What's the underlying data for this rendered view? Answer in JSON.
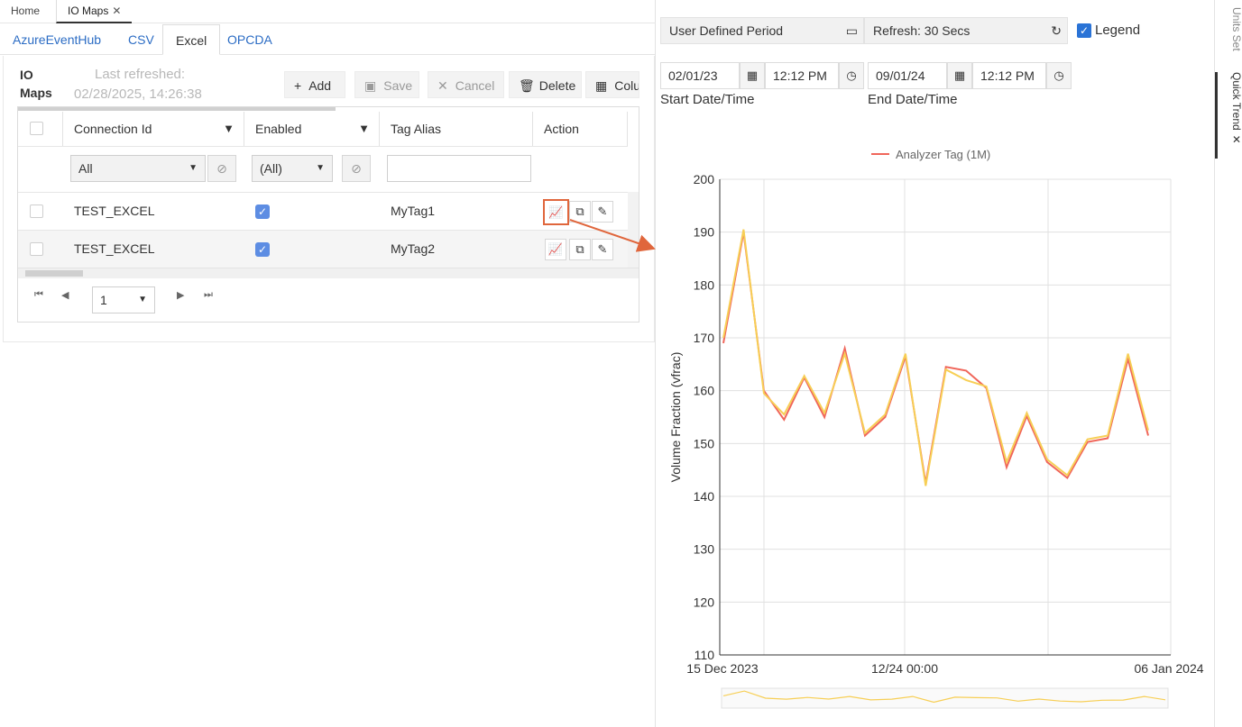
{
  "top_tabs": {
    "home": "Home",
    "io_maps": "IO Maps"
  },
  "source_tabs": [
    "AzureEventHub",
    "CSV",
    "Excel",
    "OPCDA"
  ],
  "panel": {
    "title_line1": "IO",
    "title_line2": "Maps",
    "refresh_label": "Last refreshed:",
    "refresh_time": "02/28/2025, 14:26:38"
  },
  "toolbar": {
    "add": "Add",
    "save": "Save",
    "cancel": "Cancel",
    "delete": "Delete",
    "columns": "Columns"
  },
  "grid": {
    "headers": {
      "connection_id": "Connection Id",
      "enabled": "Enabled",
      "tag_alias": "Tag Alias",
      "action": "Action"
    },
    "filters": {
      "connection_id": "All",
      "enabled": "(All)",
      "tag_alias": ""
    },
    "rows": [
      {
        "connection_id": "TEST_EXCEL",
        "enabled": true,
        "tag_alias": "MyTag1"
      },
      {
        "connection_id": "TEST_EXCEL",
        "enabled": true,
        "tag_alias": "MyTag2"
      }
    ],
    "page": "1"
  },
  "trend": {
    "period": "User Defined Period",
    "refresh": "Refresh: 30 Secs",
    "legend_label": "Legend",
    "start_date": "02/01/23",
    "start_time": "12:12 PM",
    "end_date": "09/01/24",
    "end_time": "12:12 PM",
    "start_label": "Start Date/Time",
    "end_label": "End Date/Time"
  },
  "rail": {
    "units_set": "Units Set",
    "quick_trend": "Quick Trend"
  },
  "chart_data": {
    "type": "line",
    "title": "",
    "legend": [
      "Analyzer Tag (1M)"
    ],
    "ylabel": "Volume Fraction (vfrac)",
    "ylim": [
      110,
      200
    ],
    "yticks": [
      110,
      120,
      130,
      140,
      150,
      160,
      170,
      180,
      190,
      200
    ],
    "xticklabels": [
      "15 Dec 2023",
      "12/24 00:00",
      "06 Jan 2024"
    ],
    "colors": {
      "series_a": "#f0665a",
      "series_b": "#f7cf56"
    },
    "series": [
      {
        "name": "Analyzer Tag (1M)",
        "values": [
          169,
          190,
          160,
          154.5,
          162.5,
          155,
          168,
          151.5,
          155,
          166.5,
          142.5,
          164.5,
          163.8,
          160.5,
          145.5,
          155.2,
          146.5,
          143.5,
          150.3,
          151,
          166,
          151.5
        ]
      },
      {
        "values": [
          170,
          190.5,
          159.5,
          155.5,
          162.8,
          155.8,
          167,
          152,
          155.5,
          167,
          142,
          164,
          162,
          160.8,
          146.5,
          155.8,
          147,
          144,
          150.8,
          151.5,
          167,
          152.5
        ]
      }
    ]
  }
}
